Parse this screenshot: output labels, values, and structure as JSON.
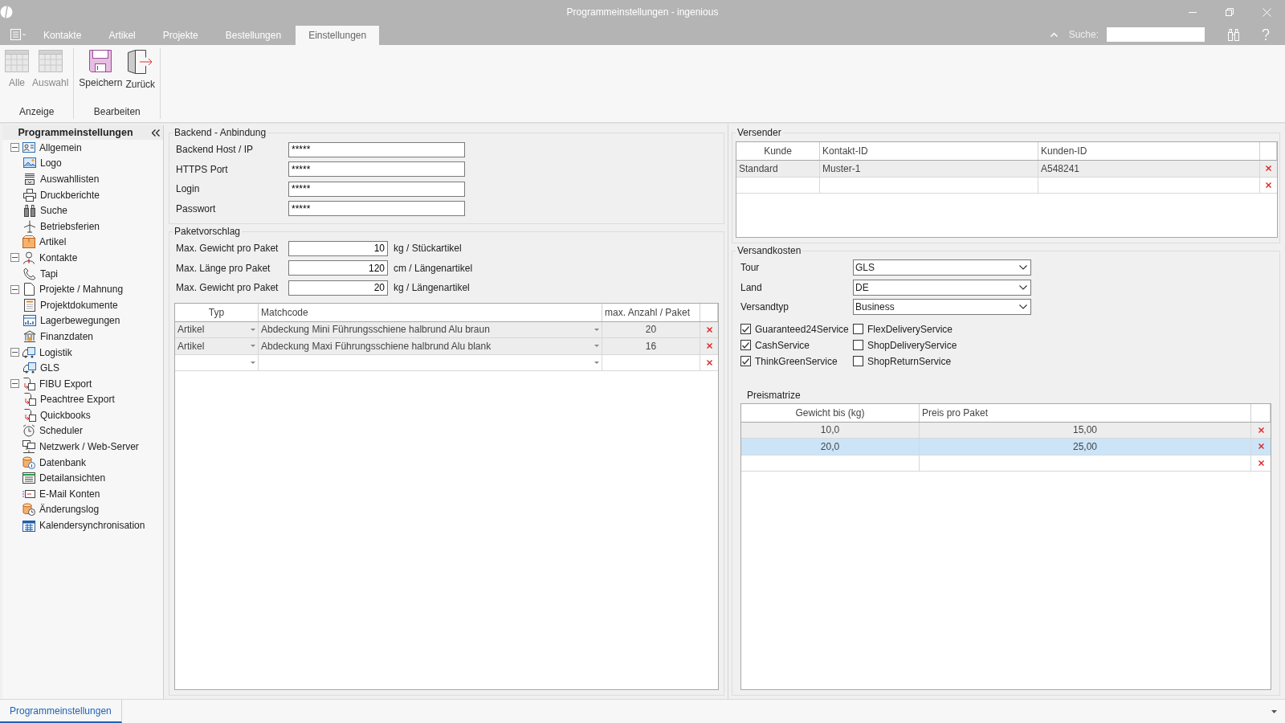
{
  "window": {
    "title": "Programmeinstellungen - ingenious"
  },
  "menu_tabs": [
    {
      "label": "Kontakte",
      "selected": false
    },
    {
      "label": "Artikel",
      "selected": false
    },
    {
      "label": "Projekte",
      "selected": false
    },
    {
      "label": "Bestellungen",
      "selected": false
    },
    {
      "label": "Einstellungen",
      "selected": true
    }
  ],
  "search": {
    "label": "Suche:"
  },
  "ribbon": {
    "groups": [
      {
        "label": "Anzeige",
        "buttons": [
          {
            "label": "Alle",
            "disabled": true
          },
          {
            "label": "Auswahl",
            "disabled": true
          }
        ]
      },
      {
        "label": "Bearbeiten",
        "buttons": [
          {
            "label": "Speichern",
            "disabled": false
          },
          {
            "label": "Zurück",
            "disabled": false
          }
        ]
      }
    ]
  },
  "sidebar": {
    "title": "Programmeinstellungen",
    "items": [
      {
        "label": "Allgemein",
        "expanded": true,
        "children": [
          {
            "label": "Logo"
          },
          {
            "label": "Auswahllisten"
          },
          {
            "label": "Druckberichte"
          },
          {
            "label": "Suche"
          },
          {
            "label": "Betriebsferien"
          }
        ]
      },
      {
        "label": "Artikel"
      },
      {
        "label": "Kontakte",
        "expanded": true,
        "children": [
          {
            "label": "Tapi"
          }
        ]
      },
      {
        "label": "Projekte / Mahnung",
        "expanded": true,
        "children": [
          {
            "label": "Projektdokumente"
          },
          {
            "label": "Lagerbewegungen"
          },
          {
            "label": "Finanzdaten"
          }
        ]
      },
      {
        "label": "Logistik",
        "expanded": true,
        "children": [
          {
            "label": "GLS"
          }
        ]
      },
      {
        "label": "FIBU Export",
        "expanded": true,
        "children": [
          {
            "label": "Peachtree Export"
          },
          {
            "label": "Quickbooks"
          }
        ]
      },
      {
        "label": "Scheduler"
      },
      {
        "label": "Netzwerk / Web-Server"
      },
      {
        "label": "Datenbank"
      },
      {
        "label": "Detailansichten"
      },
      {
        "label": "E-Mail Konten"
      },
      {
        "label": "Änderungslog"
      },
      {
        "label": "Kalendersynchronisation"
      }
    ]
  },
  "backend": {
    "title": "Backend - Anbindung",
    "fields": [
      {
        "label": "Backend Host / IP",
        "value": "*****"
      },
      {
        "label": "HTTPS Port",
        "value": "*****"
      },
      {
        "label": "Login",
        "value": "*****"
      },
      {
        "label": "Passwort",
        "value": "*****"
      }
    ]
  },
  "paketvorschlag": {
    "title": "Paketvorschlag",
    "fields": [
      {
        "label": "Max. Gewicht pro Paket",
        "value": "10",
        "unit": "kg / Stückartikel"
      },
      {
        "label": "Max. Länge pro Paket",
        "value": "120",
        "unit": "cm / Längenartikel"
      },
      {
        "label": "Max. Gewicht pro Paket",
        "value": "20",
        "unit": "kg / Längenartikel"
      }
    ],
    "table": {
      "columns": [
        {
          "label": "Typ",
          "kind": "dropdown"
        },
        {
          "label": "Matchcode",
          "kind": "dropdown"
        },
        {
          "label": "max. Anzahl / Paket",
          "kind": "number"
        }
      ],
      "rows": [
        {
          "cells": [
            "Artikel",
            "Abdeckung Mini Führungsschiene halbrund Alu braun",
            "20"
          ],
          "selected": false
        },
        {
          "cells": [
            "Artikel",
            "Abdeckung Maxi Führungsschiene halbrund Alu blank",
            "16"
          ],
          "selected": false
        }
      ]
    }
  },
  "versender": {
    "title": "Versender",
    "table": {
      "columns": [
        {
          "label": "Kunde",
          "kind": "text"
        },
        {
          "label": "Kontakt-ID",
          "kind": "text"
        },
        {
          "label": "Kunden-ID",
          "kind": "text"
        }
      ],
      "rows": [
        {
          "cells": [
            "Standard",
            "Muster-1",
            "A548241"
          ],
          "selected": false
        }
      ]
    }
  },
  "versandkosten": {
    "title": "Versandkosten",
    "selects": [
      {
        "label": "Tour",
        "value": "GLS"
      },
      {
        "label": "Land",
        "value": "DE"
      },
      {
        "label": "Versandtyp",
        "value": "Business"
      }
    ],
    "options": [
      {
        "label": "Guaranteed24Service",
        "checked": true
      },
      {
        "label": "FlexDeliveryService",
        "checked": false
      },
      {
        "label": "CashService",
        "checked": true
      },
      {
        "label": "ShopDeliveryService",
        "checked": false
      },
      {
        "label": "ThinkGreenService",
        "checked": true
      },
      {
        "label": "ShopReturnService",
        "checked": false
      }
    ],
    "matrix": {
      "title": "Preismatrize",
      "columns": [
        {
          "label": "Gewicht bis (kg)",
          "kind": "number"
        },
        {
          "label": "Preis pro Paket",
          "kind": "number"
        }
      ],
      "rows": [
        {
          "cells": [
            "10,0",
            "15,00"
          ],
          "selected": false
        },
        {
          "cells": [
            "20,0",
            "25,00"
          ],
          "selected": true
        }
      ]
    }
  },
  "bottom_tabs": [
    {
      "label": "Programmeinstellungen",
      "selected": true
    }
  ]
}
